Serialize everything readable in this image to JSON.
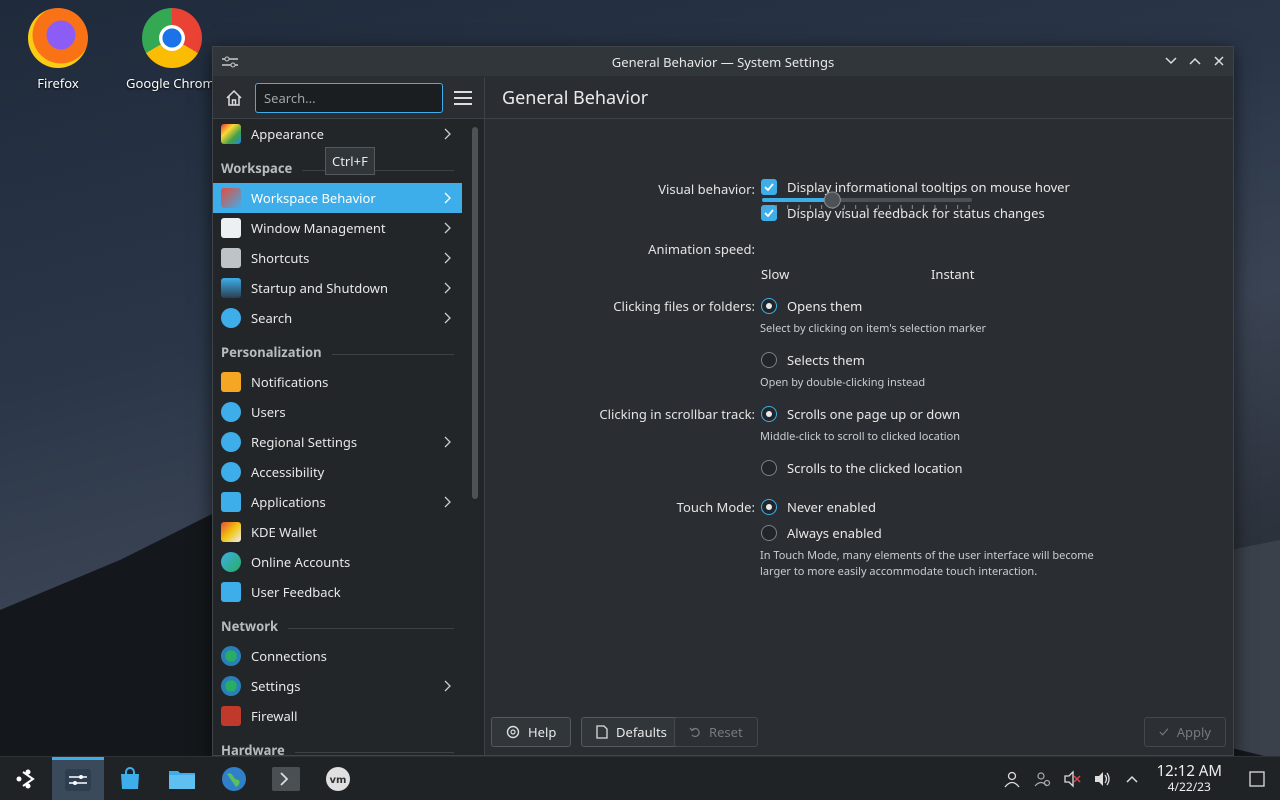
{
  "desktop": {
    "icons": [
      {
        "label": "Firefox",
        "icon": "firefox-icon"
      },
      {
        "label": "Google Chrome",
        "icon": "chrome-icon"
      }
    ]
  },
  "window": {
    "title": "General Behavior — System Settings"
  },
  "sidebar": {
    "search_placeholder": "Search...",
    "tooltip": "Ctrl+F",
    "top_item": {
      "label": "Appearance",
      "icon": "appearance-icon"
    },
    "categories": [
      {
        "title": "Workspace",
        "items": [
          {
            "label": "Workspace Behavior",
            "icon": "workspace-behavior-icon",
            "chevron": true,
            "active": true
          },
          {
            "label": "Window Management",
            "icon": "window-management-icon",
            "chevron": true
          },
          {
            "label": "Shortcuts",
            "icon": "keyboard-icon",
            "chevron": true
          },
          {
            "label": "Startup and Shutdown",
            "icon": "startup-icon",
            "chevron": true
          },
          {
            "label": "Search",
            "icon": "search-icon",
            "chevron": true
          }
        ]
      },
      {
        "title": "Personalization",
        "items": [
          {
            "label": "Notifications",
            "icon": "bell-icon"
          },
          {
            "label": "Users",
            "icon": "users-icon"
          },
          {
            "label": "Regional Settings",
            "icon": "regional-icon",
            "chevron": true
          },
          {
            "label": "Accessibility",
            "icon": "accessibility-icon"
          },
          {
            "label": "Applications",
            "icon": "applications-icon",
            "chevron": true
          },
          {
            "label": "KDE Wallet",
            "icon": "wallet-icon"
          },
          {
            "label": "Online Accounts",
            "icon": "online-accounts-icon"
          },
          {
            "label": "User Feedback",
            "icon": "feedback-icon"
          }
        ]
      },
      {
        "title": "Network",
        "items": [
          {
            "label": "Connections",
            "icon": "globe-icon"
          },
          {
            "label": "Settings",
            "icon": "network-settings-icon",
            "chevron": true
          },
          {
            "label": "Firewall",
            "icon": "firewall-icon"
          }
        ]
      },
      {
        "title": "Hardware",
        "items": []
      }
    ]
  },
  "content": {
    "heading": "General Behavior",
    "visual_behavior": {
      "label": "Visual behavior:",
      "tooltips": "Display informational tooltips on mouse hover",
      "feedback": "Display visual feedback for status changes"
    },
    "animation": {
      "label": "Animation speed:",
      "slow": "Slow",
      "instant": "Instant",
      "value_fraction": 0.33
    },
    "clicking_files": {
      "label": "Clicking files or folders:",
      "opt1": "Opens them",
      "note1": "Select by clicking on item's selection marker",
      "opt2": "Selects them",
      "note2": "Open by double-clicking instead"
    },
    "scrollbar": {
      "label": "Clicking in scrollbar track:",
      "opt1": "Scrolls one page up or down",
      "note1": "Middle-click to scroll to clicked location",
      "opt2": "Scrolls to the clicked location"
    },
    "touch": {
      "label": "Touch Mode:",
      "opt1": "Never enabled",
      "opt2": "Always enabled",
      "note1": "In Touch Mode, many elements of the user interface will become",
      "note2": "larger to more easily accommodate touch interaction."
    },
    "buttons": {
      "help": "Help",
      "defaults": "Defaults",
      "reset": "Reset",
      "apply": "Apply"
    }
  },
  "taskbar": {
    "time": "12:12 AM",
    "date": "4/22/23"
  },
  "colors": {
    "accent": "#3daee9"
  }
}
